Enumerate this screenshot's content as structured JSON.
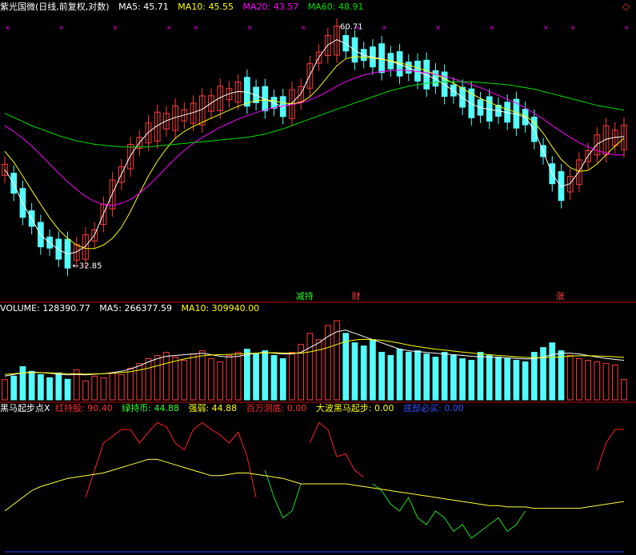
{
  "main": {
    "title": "紫光国微(日线,前复权,对数)",
    "ma5": "MA5: 45.71",
    "ma10": "MA10: 45.55",
    "ma20": "MA20: 43.57",
    "ma60": "MA60: 48.91",
    "high_label": "60.71",
    "low_label": "32.85",
    "flags": [
      "减持",
      "财",
      "涨"
    ],
    "corner_icon": "diamond-icon"
  },
  "volume": {
    "label": "VOLUME: 128390.77",
    "ma5": "MA5: 266377.59",
    "ma10": "MA10: 309940.00"
  },
  "indicator": {
    "name": "黑马起步点X",
    "red_holding": "红持股: 90.40",
    "green_holding": "绿持币: 44.88",
    "strength": "强弱: 44.88",
    "million_test": "百万测底: 0.00",
    "big_wave": "大波黑马起步: 0.00",
    "bottom_buy": "底部必买: 0.00"
  },
  "colors": {
    "up": "#ff3b3b",
    "down": "#54fcfc",
    "ma5": "#ffffff",
    "ma10": "#ffff00",
    "ma20": "#ff00ff",
    "ma60": "#00e000",
    "red_line": "#ff2020",
    "green_line": "#20e020",
    "yellow_line": "#ffff40",
    "blue_line": "#2040ff"
  },
  "chart_data": [
    {
      "type": "candlestick",
      "title": "紫光国微(日线,前复权,对数)",
      "scale": "log",
      "ylim": [
        31,
        62
      ],
      "annotations": {
        "high": 60.71,
        "low": 32.85
      },
      "series": [
        {
          "name": "MA5",
          "values": [
            42,
            40.5,
            38.5,
            37,
            35.5,
            34.8,
            34.2,
            33.8,
            34,
            34.5,
            35.5,
            37.5,
            39.5,
            41.5,
            43.5,
            45,
            46.2,
            47,
            47.6,
            48,
            48.3,
            48.6,
            49,
            49.8,
            50.5,
            51,
            51.3,
            51.2,
            50.8,
            50.3,
            49.8,
            49.3,
            49.8,
            51,
            53.5,
            56,
            57.8,
            58.6,
            58,
            57,
            56.3,
            56,
            55.8,
            55.4,
            55,
            54.5,
            54,
            53.5,
            53,
            52.2,
            51.4,
            50.5,
            49.7,
            49.2,
            49,
            48.8,
            48.6,
            48.4,
            48,
            46.5,
            44,
            41.5,
            40.2,
            40.5,
            41.8,
            43.5,
            44.8,
            45.4,
            45.6,
            45.7
          ]
        },
        {
          "name": "MA10",
          "values": [
            44,
            42.8,
            41.3,
            39.8,
            38.4,
            37.1,
            36,
            35.2,
            34.6,
            34.3,
            34.3,
            34.6,
            35.2,
            36.2,
            37.7,
            39.5,
            41.3,
            42.9,
            44.3,
            45.5,
            46.3,
            46.9,
            47.4,
            47.9,
            48.4,
            48.9,
            49.4,
            49.8,
            50.1,
            50.2,
            50.1,
            49.8,
            49.7,
            49.9,
            50.6,
            51.8,
            53.3,
            54.8,
            55.8,
            56.1,
            56,
            55.9,
            55.7,
            55.5,
            55.2,
            54.9,
            54.5,
            54.1,
            53.6,
            53,
            52.4,
            51.7,
            51,
            50.4,
            49.9,
            49.4,
            49,
            48.6,
            48.2,
            47.4,
            46.1,
            44.5,
            43.1,
            42.2,
            41.8,
            41.9,
            42.6,
            43.6,
            44.6,
            45.5
          ]
        },
        {
          "name": "MA20",
          "values": [
            47,
            46.3,
            45.5,
            44.6,
            43.6,
            42.6,
            41.6,
            40.7,
            39.9,
            39.2,
            38.7,
            38.4,
            38.3,
            38.5,
            38.9,
            39.5,
            40.3,
            41.2,
            42.2,
            43.2,
            44.1,
            44.9,
            45.6,
            46.2,
            46.8,
            47.3,
            47.8,
            48.2,
            48.6,
            48.9,
            49.2,
            49.4,
            49.6,
            49.8,
            50.2,
            50.7,
            51.3,
            52,
            52.6,
            53.1,
            53.5,
            53.8,
            54,
            54.1,
            54.2,
            54.1,
            54,
            53.8,
            53.6,
            53.3,
            53,
            52.6,
            52.2,
            51.8,
            51.3,
            50.8,
            50.3,
            49.8,
            49.2,
            48.5,
            47.8,
            47,
            46.3,
            45.6,
            45,
            44.5,
            44.1,
            43.8,
            43.6,
            43.6
          ]
        },
        {
          "name": "MA60",
          "values": [
            48.5,
            48,
            47.5,
            47,
            46.6,
            46.2,
            45.8,
            45.5,
            45.2,
            45,
            44.8,
            44.7,
            44.6,
            44.5,
            44.5,
            44.5,
            44.5,
            44.6,
            44.7,
            44.8,
            44.9,
            45,
            45.1,
            45.2,
            45.3,
            45.4,
            45.5,
            45.6,
            45.8,
            46,
            46.3,
            46.6,
            47,
            47.4,
            47.8,
            48.2,
            48.6,
            49,
            49.4,
            49.8,
            50.2,
            50.6,
            51,
            51.4,
            51.7,
            52,
            52.2,
            52.4,
            52.5,
            52.6,
            52.6,
            52.6,
            52.6,
            52.5,
            52.4,
            52.3,
            52.2,
            52,
            51.8,
            51.6,
            51.3,
            51,
            50.7,
            50.4,
            50.1,
            49.8,
            49.5,
            49.3,
            49.1,
            48.9
          ]
        }
      ]
    },
    {
      "type": "bar",
      "title": "VOLUME",
      "values": [
        128,
        150,
        210,
        180,
        160,
        140,
        170,
        130,
        190,
        120,
        150,
        140,
        170,
        160,
        200,
        230,
        260,
        280,
        300,
        270,
        250,
        290,
        310,
        260,
        240,
        280,
        300,
        320,
        290,
        310,
        280,
        260,
        300,
        350,
        420,
        380,
        470,
        500,
        420,
        360,
        340,
        380,
        300,
        280,
        320,
        300,
        310,
        290,
        270,
        300,
        280,
        260,
        250,
        300,
        280,
        270,
        260,
        250,
        240,
        300,
        330,
        360,
        310,
        280,
        260,
        250,
        240,
        230,
        220,
        128
      ],
      "series": [
        {
          "name": "MA5",
          "values": [
            150,
            160,
            170,
            175,
            172,
            168,
            162,
            158,
            160,
            158,
            162,
            165,
            172,
            180,
            195,
            215,
            240,
            260,
            275,
            280,
            285,
            290,
            295,
            285,
            275,
            270,
            275,
            285,
            295,
            300,
            295,
            290,
            290,
            300,
            330,
            360,
            400,
            430,
            440,
            420,
            400,
            380,
            360,
            340,
            320,
            310,
            305,
            300,
            295,
            290,
            285,
            280,
            275,
            272,
            270,
            268,
            265,
            262,
            258,
            260,
            270,
            285,
            295,
            295,
            290,
            280,
            270,
            262,
            255,
            250
          ]
        },
        {
          "name": "MA10",
          "values": [
            160,
            165,
            170,
            172,
            172,
            170,
            168,
            165,
            164,
            163,
            164,
            165,
            168,
            172,
            178,
            188,
            200,
            215,
            230,
            245,
            258,
            268,
            278,
            283,
            285,
            287,
            290,
            293,
            295,
            297,
            298,
            296,
            294,
            295,
            303,
            315,
            330,
            350,
            368,
            378,
            382,
            380,
            376,
            368,
            358,
            346,
            336,
            328,
            320,
            314,
            308,
            302,
            296,
            290,
            285,
            280,
            276,
            272,
            268,
            266,
            266,
            268,
            272,
            276,
            278,
            278,
            277,
            275,
            272,
            268
          ]
        }
      ]
    },
    {
      "type": "line",
      "title": "黑马起步点X",
      "ylim": [
        0,
        100
      ],
      "series": [
        {
          "name": "红持股",
          "values": [
            null,
            null,
            null,
            null,
            null,
            null,
            null,
            null,
            null,
            40,
            60,
            80,
            85,
            90,
            90,
            80,
            88,
            95,
            92,
            80,
            75,
            90,
            95,
            90,
            86,
            80,
            88,
            70,
            40,
            null,
            null,
            null,
            null,
            null,
            80,
            95,
            90,
            70,
            72,
            60,
            55,
            null,
            null,
            null,
            null,
            null,
            null,
            null,
            null,
            null,
            null,
            null,
            null,
            null,
            null,
            null,
            null,
            null,
            null,
            null,
            null,
            null,
            null,
            null,
            null,
            null,
            60,
            80,
            90,
            90
          ]
        },
        {
          "name": "绿持币",
          "values": [
            null,
            null,
            null,
            null,
            null,
            null,
            null,
            null,
            null,
            null,
            null,
            null,
            null,
            null,
            null,
            null,
            null,
            null,
            null,
            null,
            null,
            null,
            null,
            null,
            null,
            null,
            null,
            null,
            null,
            60,
            40,
            25,
            30,
            50,
            null,
            null,
            null,
            null,
            null,
            null,
            null,
            50,
            45,
            35,
            30,
            40,
            25,
            20,
            30,
            25,
            15,
            20,
            10,
            15,
            20,
            25,
            15,
            20,
            30,
            null,
            null,
            null,
            null,
            null,
            null,
            null,
            null,
            null,
            null,
            null
          ]
        },
        {
          "name": "强弱",
          "values": [
            30,
            35,
            40,
            45,
            48,
            50,
            52,
            54,
            55,
            56,
            57,
            58,
            60,
            62,
            64,
            66,
            68,
            68,
            66,
            64,
            62,
            60,
            58,
            56,
            56,
            57,
            58,
            58,
            57,
            56,
            55,
            54,
            52,
            50,
            50,
            50,
            50,
            50,
            50,
            49,
            48,
            47,
            46,
            45,
            44,
            43,
            42,
            41,
            40,
            39,
            38,
            37,
            36,
            35,
            34,
            34,
            33,
            33,
            33,
            32,
            32,
            32,
            32,
            32,
            32,
            33,
            34,
            35,
            36,
            37
          ]
        },
        {
          "name": "百万测底",
          "values": [
            0,
            0,
            0,
            0,
            0,
            0,
            0,
            0,
            0,
            0,
            0,
            0,
            0,
            0,
            0,
            0,
            0,
            0,
            0,
            0,
            0,
            0,
            0,
            0,
            0,
            0,
            0,
            0,
            0,
            0,
            0,
            0,
            0,
            0,
            0,
            0,
            0,
            0,
            0,
            0,
            0,
            0,
            0,
            0,
            0,
            0,
            0,
            0,
            0,
            0,
            0,
            0,
            0,
            0,
            0,
            0,
            0,
            0,
            0,
            0,
            0,
            0,
            0,
            0,
            0,
            0,
            0,
            0,
            0,
            0
          ]
        },
        {
          "name": "大波黑马起步",
          "values": [
            0,
            0,
            0,
            0,
            0,
            0,
            0,
            0,
            0,
            0,
            0,
            0,
            0,
            0,
            0,
            0,
            0,
            0,
            0,
            0,
            0,
            0,
            0,
            0,
            0,
            0,
            0,
            0,
            0,
            0,
            0,
            0,
            0,
            0,
            0,
            0,
            0,
            0,
            0,
            0,
            0,
            0,
            0,
            0,
            0,
            0,
            0,
            0,
            0,
            0,
            0,
            0,
            0,
            0,
            0,
            0,
            0,
            0,
            0,
            0,
            0,
            0,
            0,
            0,
            0,
            0,
            0,
            0,
            0,
            0
          ]
        },
        {
          "name": "底部必买",
          "values": [
            0,
            0,
            0,
            0,
            0,
            0,
            0,
            0,
            0,
            0,
            0,
            0,
            0,
            0,
            0,
            0,
            0,
            0,
            0,
            0,
            0,
            0,
            0,
            0,
            0,
            0,
            0,
            0,
            0,
            0,
            0,
            0,
            0,
            0,
            0,
            0,
            0,
            0,
            0,
            0,
            0,
            0,
            0,
            0,
            0,
            0,
            0,
            0,
            0,
            0,
            0,
            0,
            0,
            0,
            0,
            0,
            0,
            0,
            0,
            0,
            0,
            0,
            0,
            0,
            0,
            0,
            0,
            0,
            0,
            0
          ]
        }
      ]
    }
  ]
}
